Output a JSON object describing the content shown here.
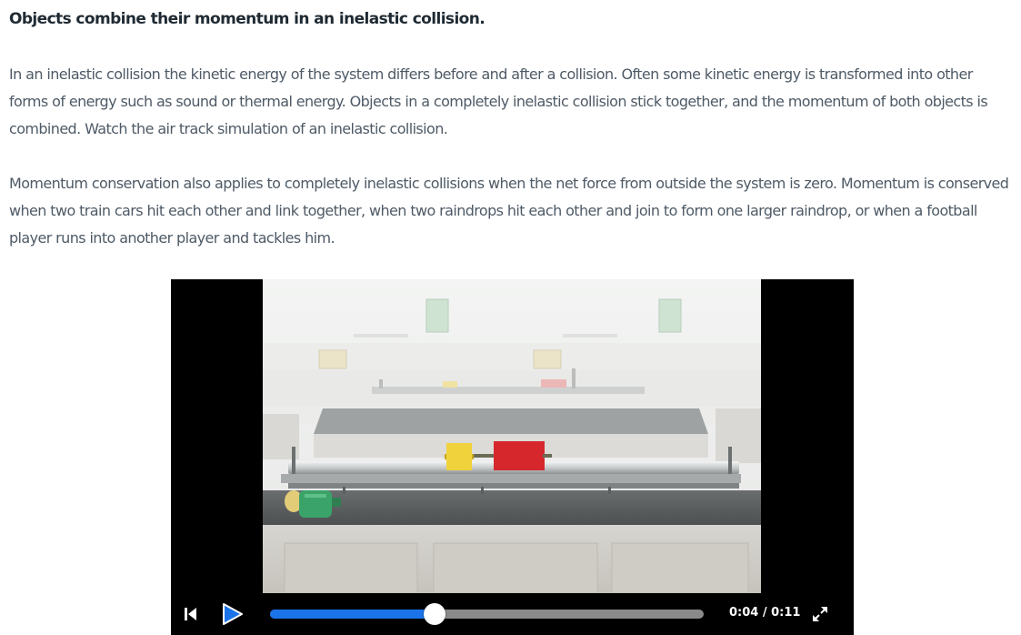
{
  "article": {
    "heading": "Objects combine their momentum in an inelastic collision.",
    "paragraphs": [
      "In an inelastic collision the kinetic energy of the system differs before and after a collision. Often some kinetic energy is transformed into other forms of energy such as sound or thermal energy. Objects in a completely inelastic collision stick together, and the momentum of both objects is combined. Watch the air track simulation of an inelastic collision.",
      "Momentum conservation also applies to completely inelastic collisions when the net force from outside the system is zero. Momentum is conserved when two train cars hit each other and link together, when two raindrops hit each other and join to form one larger raindrop, or when a football player runs into another player and tackles him."
    ]
  },
  "video": {
    "time_display": "0:04 / 0:11",
    "progress_fraction": 0.38,
    "icons": {
      "restart": "skip-to-start-icon",
      "play": "play-icon",
      "fullscreen": "fullscreen-icon"
    },
    "colors": {
      "play": "#1a73e8",
      "seek_fill": "#1a73e8",
      "glider_left": "#f0d23c",
      "glider_right": "#d6282c",
      "blower": "#3aa36a"
    }
  }
}
